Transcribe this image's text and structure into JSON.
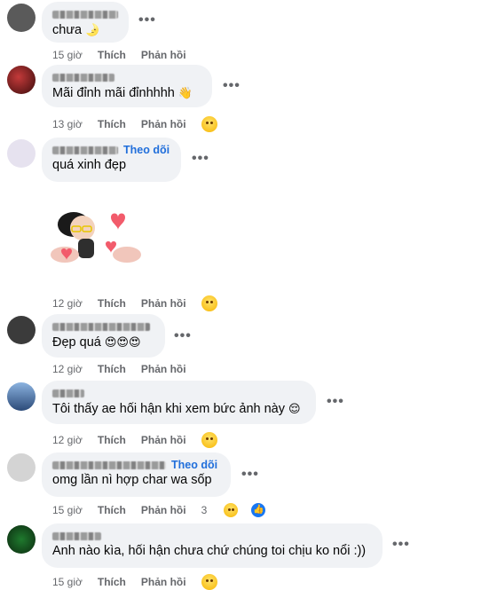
{
  "comments": [
    {
      "name": "",
      "text": "chưa",
      "emoji": "🌛",
      "time": "15 giờ",
      "like": "Thích",
      "reply": "Phản hồi"
    },
    {
      "name": "",
      "text": "Mãi đỉnh mãi đỉnhhhh",
      "emoji": "👋",
      "time": "13 giờ",
      "like": "Thích",
      "reply": "Phản hồi",
      "reaction": "haha"
    },
    {
      "name": "",
      "follow": "Theo dõi",
      "text": "quá xinh đẹp"
    },
    {
      "time": "12 giờ",
      "like": "Thích",
      "reply": "Phản hồi",
      "reaction": "care"
    },
    {
      "name": "",
      "text": "Đẹp quá",
      "emoji": "😍😍😍",
      "time": "12 giờ",
      "like": "Thích",
      "reply": "Phản hồi"
    },
    {
      "name": "",
      "text": "Tôi thấy ae hối hận khi xem bức ảnh này",
      "emoji": "😌",
      "time": "12 giờ",
      "like": "Thích",
      "reply": "Phản hồi",
      "reaction": "haha"
    },
    {
      "name": "",
      "follow": "Theo dõi",
      "text": "omg lần nì hợp char wa sốp",
      "time": "15 giờ",
      "like": "Thích",
      "reply": "Phản hồi",
      "reaction_count": "3"
    },
    {
      "name": "",
      "text": "Anh nào kìa, hối hận chưa chứ chúng toi chịu ko nổi :))",
      "time": "15 giờ",
      "like": "Thích",
      "reply": "Phản hồi",
      "reaction": "haha"
    }
  ],
  "more_label": "•••",
  "colors": {
    "bubble": "#f0f2f5",
    "link": "#216fdb",
    "meta": "#65676b"
  }
}
